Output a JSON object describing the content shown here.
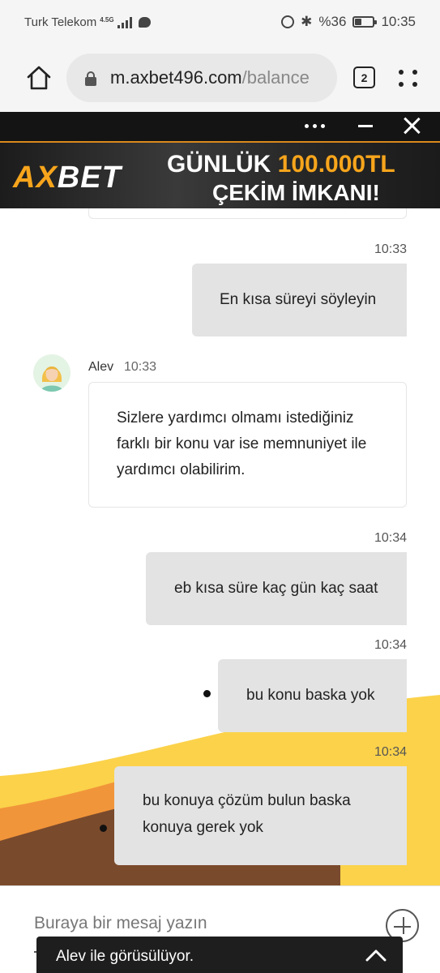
{
  "status_bar": {
    "carrier": "Turk Telekom",
    "network_type": "4.5G",
    "battery_percent": "%36",
    "battery_level": 0.36,
    "time": "10:35"
  },
  "browser": {
    "url_domain": "m.axbet496.com",
    "url_path": "/balance",
    "tab_count": "2"
  },
  "ad": {
    "logo_ax": "AX",
    "logo_bet": "BET",
    "line1_prefix": "GÜNLÜK ",
    "line1_amount": "100.000TL",
    "line2": "ÇEKİM İMKANI!"
  },
  "chat": {
    "messages": [
      {
        "time": "10:33",
        "text": "En kısa süreyi söyleyin"
      },
      {
        "time": "10:34",
        "text": "eb kısa süre kaç gün kaç saat"
      },
      {
        "time": "10:34",
        "text": "bu konu baska yok"
      },
      {
        "time": "10:34",
        "lines": [
          "bu konuya çözüm bulun baska",
          "konuya gerek yok"
        ]
      }
    ],
    "agent_message": {
      "name": "Alev",
      "time": "10:33",
      "lines": [
        "Sizlere yardımcı olmamı istediğiniz",
        "farklı bir konu var ise memnuniyet ile",
        "yardımcı olabilirim."
      ]
    }
  },
  "composer": {
    "placeholder": "Buraya bir mesaj yazın"
  },
  "agent_bar": {
    "label": "Alev ile görüsülüyor."
  },
  "colors": {
    "ad_accent": "#f7a51c",
    "wave_yellow": "#fbd24a",
    "wave_orange": "#f1953a",
    "wave_brown": "#7a4a2c",
    "bubble_grey": "#e3e3e3"
  }
}
